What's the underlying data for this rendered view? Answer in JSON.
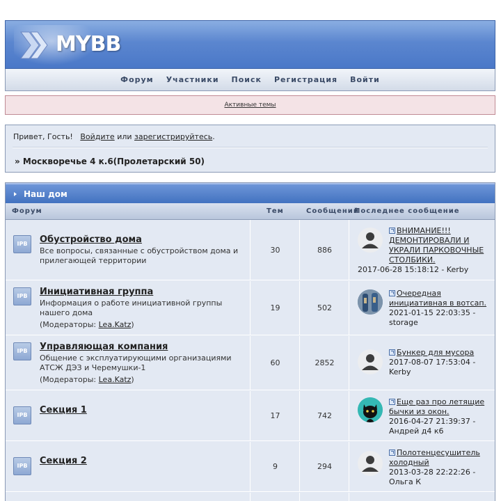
{
  "header": {
    "logo_text": "MYBB"
  },
  "nav": {
    "items": [
      "Форум",
      "Участники",
      "Поиск",
      "Регистрация",
      "Войти"
    ]
  },
  "alert": {
    "link": "Активные темы"
  },
  "welcome": {
    "greeting": "Привет, Гость!",
    "login": "Войдите",
    "or": "или",
    "register": "зарегистрируйтесь",
    "dot": ".",
    "breadcrumb": "» Москворечье 4 к.6(Пролетарский 50)"
  },
  "category": {
    "title": "Наш дом",
    "columns": {
      "forum": "Форум",
      "topics": "Тем",
      "posts": "Сообщений",
      "last": "Последнее сообщение"
    }
  },
  "forums": [
    {
      "icon": "IPB",
      "title": "Обустройство дома",
      "desc": "Все вопросы, связанные с обустройством дома и прилегающей территории",
      "mods_prefix": "",
      "mods_name": "",
      "mods_suffix": "",
      "topics": "30",
      "posts": "886",
      "last_title": "ВНИМАНИЕ!!! ДЕМОНТИРОВАЛИ И УКРАЛИ ПАРКОВОЧНЫЕ СТОЛБИКИ.",
      "last_meta": "2017-06-28 15:18:12 - Kerby",
      "avatar": "default-avatar"
    },
    {
      "icon": "IPB",
      "title": "Инициативная группа",
      "desc": "Информация о работе инициативной группы нашего дома",
      "mods_prefix": "(Модераторы: ",
      "mods_name": "Lea.Katz",
      "mods_suffix": ")",
      "topics": "19",
      "posts": "502",
      "last_title": "Очередная инициативная в вотсап.",
      "last_meta": "2021-01-15 22:03:35 - storage",
      "avatar": "photo-avatar"
    },
    {
      "icon": "IPB",
      "title": "Управляющая компания",
      "desc": "Общение с эксплуатирующими организациями АТСЖ ДЭЗ и Черемушки-1",
      "mods_prefix": "(Модераторы: ",
      "mods_name": "Lea.Katz",
      "mods_suffix": ")",
      "topics": "60",
      "posts": "2852",
      "last_title": "Бункер для мусора",
      "last_meta": "2017-08-07 17:53:04 - Kerby",
      "avatar": "default-avatar"
    },
    {
      "icon": "IPB",
      "title": "Секция 1",
      "desc": "",
      "mods_prefix": "",
      "mods_name": "",
      "mods_suffix": "",
      "topics": "17",
      "posts": "742",
      "last_title": "Еще раз про летящие бычки из окон.",
      "last_meta": "2016-04-27 21:39:37 - Андрей д4 к6",
      "avatar": "cat-avatar"
    },
    {
      "icon": "IPB",
      "title": "Секция 2",
      "desc": "",
      "mods_prefix": "",
      "mods_name": "",
      "mods_suffix": "",
      "topics": "9",
      "posts": "294",
      "last_title": "Полотенцесушитель холодный",
      "last_meta": "2013-03-28 22:22:26 - Ольга К",
      "avatar": "default-avatar"
    }
  ]
}
